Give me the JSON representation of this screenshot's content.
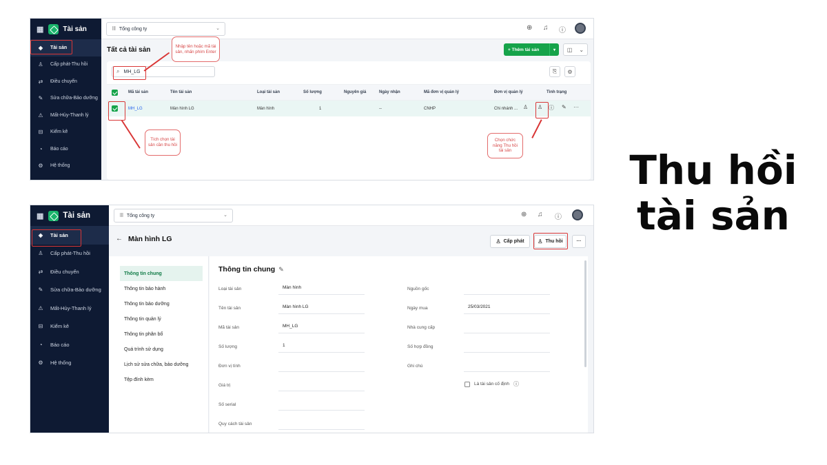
{
  "heading": [
    "Thu hồi",
    "tài sản"
  ],
  "app": {
    "name": "Tài sản",
    "company": "Tổng công ty"
  },
  "sidebar": {
    "items": [
      {
        "label": "Tài sản",
        "icon": "box-icon"
      },
      {
        "label": "Cấp phát-Thu hồi",
        "icon": "user-assign-icon"
      },
      {
        "label": "Điều chuyển",
        "icon": "transfer-icon"
      },
      {
        "label": "Sửa chữa-Bảo dưỡng",
        "icon": "wrench-icon"
      },
      {
        "label": "Mất-Hủy-Thanh lý",
        "icon": "warning-icon"
      },
      {
        "label": "Kiểm kê",
        "icon": "inbox-icon"
      },
      {
        "label": "Báo cáo",
        "icon": "pie-chart-icon"
      },
      {
        "label": "Hệ thống",
        "icon": "settings-icon"
      }
    ]
  },
  "list_view": {
    "title": "Tất cả tài sản",
    "add_button": "+ Thêm tài sản",
    "search_value": "MH_LG",
    "columns": [
      "Mã tài sản",
      "Tên tài sản",
      "Loại tài sản",
      "Số lượng",
      "Nguyên giá",
      "Ngày nhận",
      "Mã đơn vị quản lý",
      "Đơn vị quản lý",
      "Tình trạng"
    ],
    "row": {
      "code": "MH_LG",
      "name": "Màn hình LG",
      "type": "Màn hình",
      "quantity": "1",
      "cost": "",
      "received": "--",
      "unit_code": "CNHP",
      "unit": "Chi nhánh ..."
    },
    "callouts": {
      "search": "Nhập tên hoặc mã tài sản, nhấn phím Enter",
      "checkbox": "Tích chọn tài sản cần thu hồi",
      "action": "Chọn chức năng Thu hồi tài sản"
    }
  },
  "detail_view": {
    "title": "Màn hình LG",
    "buttons": {
      "assign": "Cấp phát",
      "revoke": "Thu hồi",
      "more": "···"
    },
    "tabs": [
      "Thông tin chung",
      "Thông tin bảo hành",
      "Thông tin bảo dưỡng",
      "Thông tin quản lý",
      "Thông tin phân bổ",
      "Quá trình sử dụng",
      "Lịch sử sửa chữa, bảo dưỡng",
      "Tệp đính kèm"
    ],
    "section_title": "Thông tin chung",
    "left_fields": [
      {
        "label": "Loại tài sản",
        "value": "Màn hình"
      },
      {
        "label": "Tên tài sản",
        "value": "Màn hình LG"
      },
      {
        "label": "Mã tài sản",
        "value": "MH_LG"
      },
      {
        "label": "Số lượng",
        "value": "1"
      },
      {
        "label": "Đơn vị tính",
        "value": ""
      },
      {
        "label": "Giá trị",
        "value": ""
      },
      {
        "label": "Số serial",
        "value": ""
      },
      {
        "label": "Quy cách tài sản",
        "value": ""
      }
    ],
    "right_fields": [
      {
        "label": "Nguồn gốc",
        "value": ""
      },
      {
        "label": "Ngày mua",
        "value": "25/03/2021"
      },
      {
        "label": "Nhà cung cấp",
        "value": ""
      },
      {
        "label": "Số hợp đồng",
        "value": ""
      },
      {
        "label": "Ghi chú",
        "value": ""
      }
    ],
    "fixed_asset_label": "Là tài sản cố định"
  },
  "colors": {
    "sidebar": "#0e1a33",
    "accent": "#16a34a",
    "highlight": "#d93636"
  }
}
